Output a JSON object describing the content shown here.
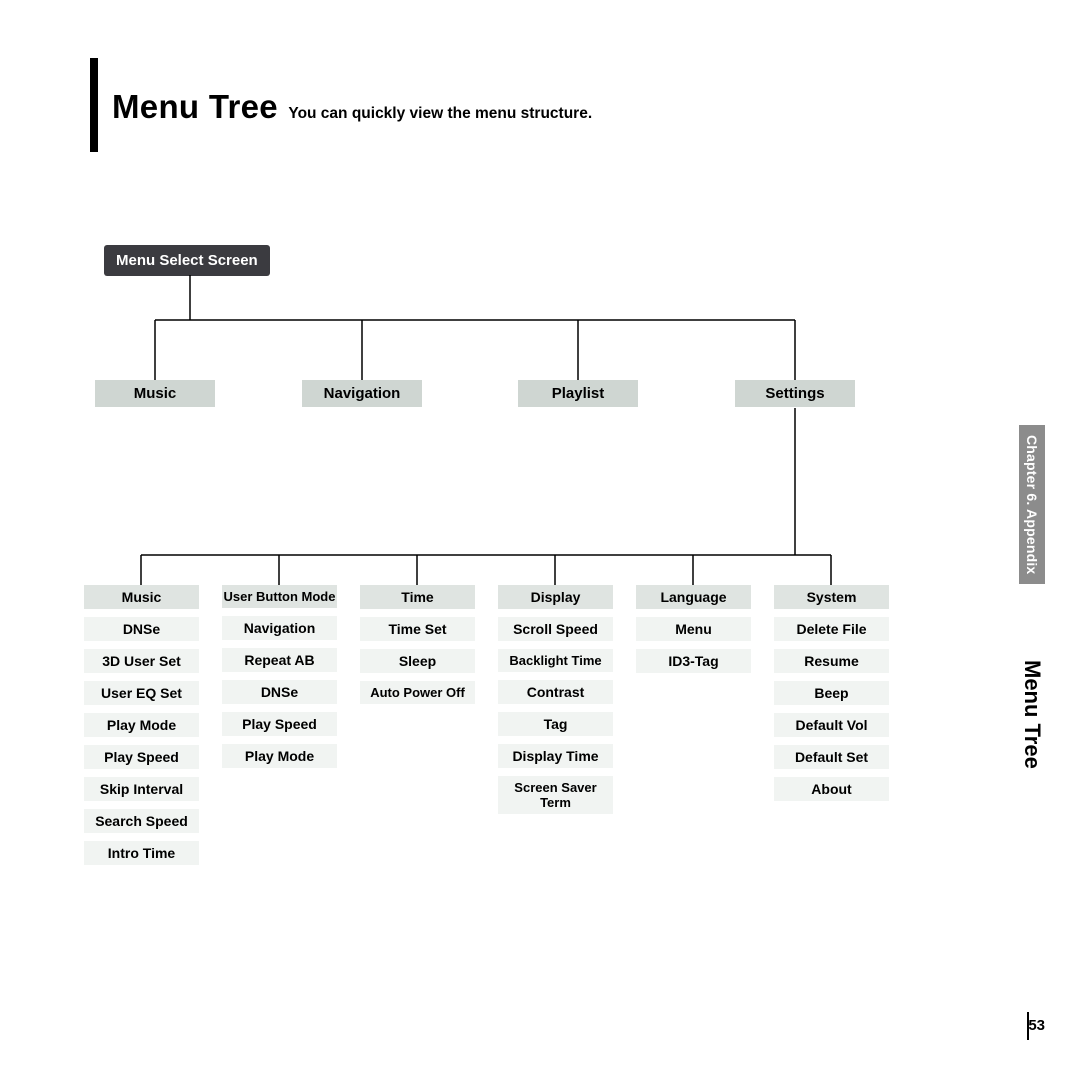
{
  "title": {
    "main": "Menu Tree",
    "sub": "You can quickly view the menu structure."
  },
  "side": {
    "chapter": "Chapter 6. Appendix",
    "section": "Menu Tree"
  },
  "page_number": "53",
  "tree": {
    "root": "Menu Select Screen",
    "level1": [
      "Music",
      "Navigation",
      "Playlist",
      "Settings"
    ],
    "settings_columns": [
      {
        "head": "Music",
        "items": [
          "DNSe",
          "3D User Set",
          "User EQ Set",
          "Play Mode",
          "Play Speed",
          "Skip Interval",
          "Search Speed",
          "Intro Time"
        ]
      },
      {
        "head": "User Button Mode",
        "items": [
          "Navigation",
          "Repeat AB",
          "DNSe",
          "Play Speed",
          "Play Mode"
        ]
      },
      {
        "head": "Time",
        "items": [
          "Time Set",
          "Sleep",
          "Auto Power Off"
        ]
      },
      {
        "head": "Display",
        "items": [
          "Scroll Speed",
          "Backlight Time",
          "Contrast",
          "Tag",
          "Display Time",
          "Screen Saver Term"
        ]
      },
      {
        "head": "Language",
        "items": [
          "Menu",
          "ID3-Tag"
        ]
      },
      {
        "head": "System",
        "items": [
          "Delete File",
          "Resume",
          "Beep",
          "Default Vol",
          "Default Set",
          "About"
        ]
      }
    ]
  }
}
